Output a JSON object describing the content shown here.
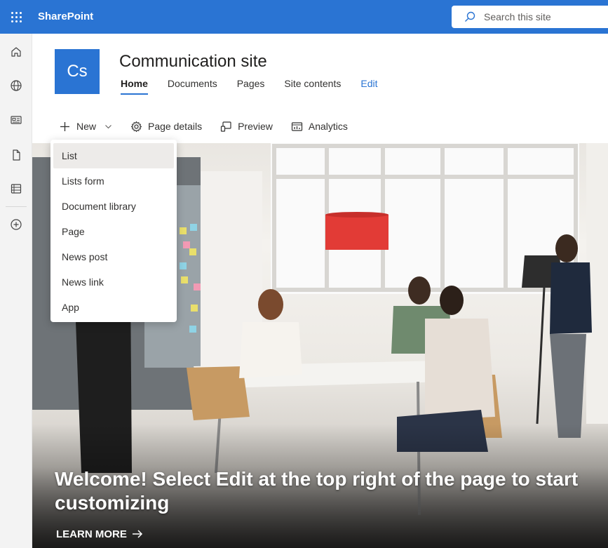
{
  "suite": {
    "brand": "SharePoint",
    "search_placeholder": "Search this site"
  },
  "site": {
    "logo_initials": "Cs",
    "title": "Communication site",
    "nav": [
      {
        "label": "Home"
      },
      {
        "label": "Documents"
      },
      {
        "label": "Pages"
      },
      {
        "label": "Site contents"
      },
      {
        "label": "Edit"
      }
    ]
  },
  "commandbar": {
    "new_label": "New",
    "page_details_label": "Page details",
    "preview_label": "Preview",
    "analytics_label": "Analytics"
  },
  "new_menu": {
    "items": [
      {
        "label": "List"
      },
      {
        "label": "Lists form"
      },
      {
        "label": "Document library"
      },
      {
        "label": "Page"
      },
      {
        "label": "News post"
      },
      {
        "label": "News link"
      },
      {
        "label": "App"
      }
    ]
  },
  "hero": {
    "title": "Welcome! Select Edit at the top right of the page to start customizing",
    "link_label": "LEARN MORE"
  },
  "rail_icons": [
    "home-icon",
    "globe-icon",
    "news-icon",
    "document-icon",
    "list-icon",
    "add-icon"
  ],
  "colors": {
    "brand": "#2a74d3",
    "rail": "#f3f3f3"
  }
}
